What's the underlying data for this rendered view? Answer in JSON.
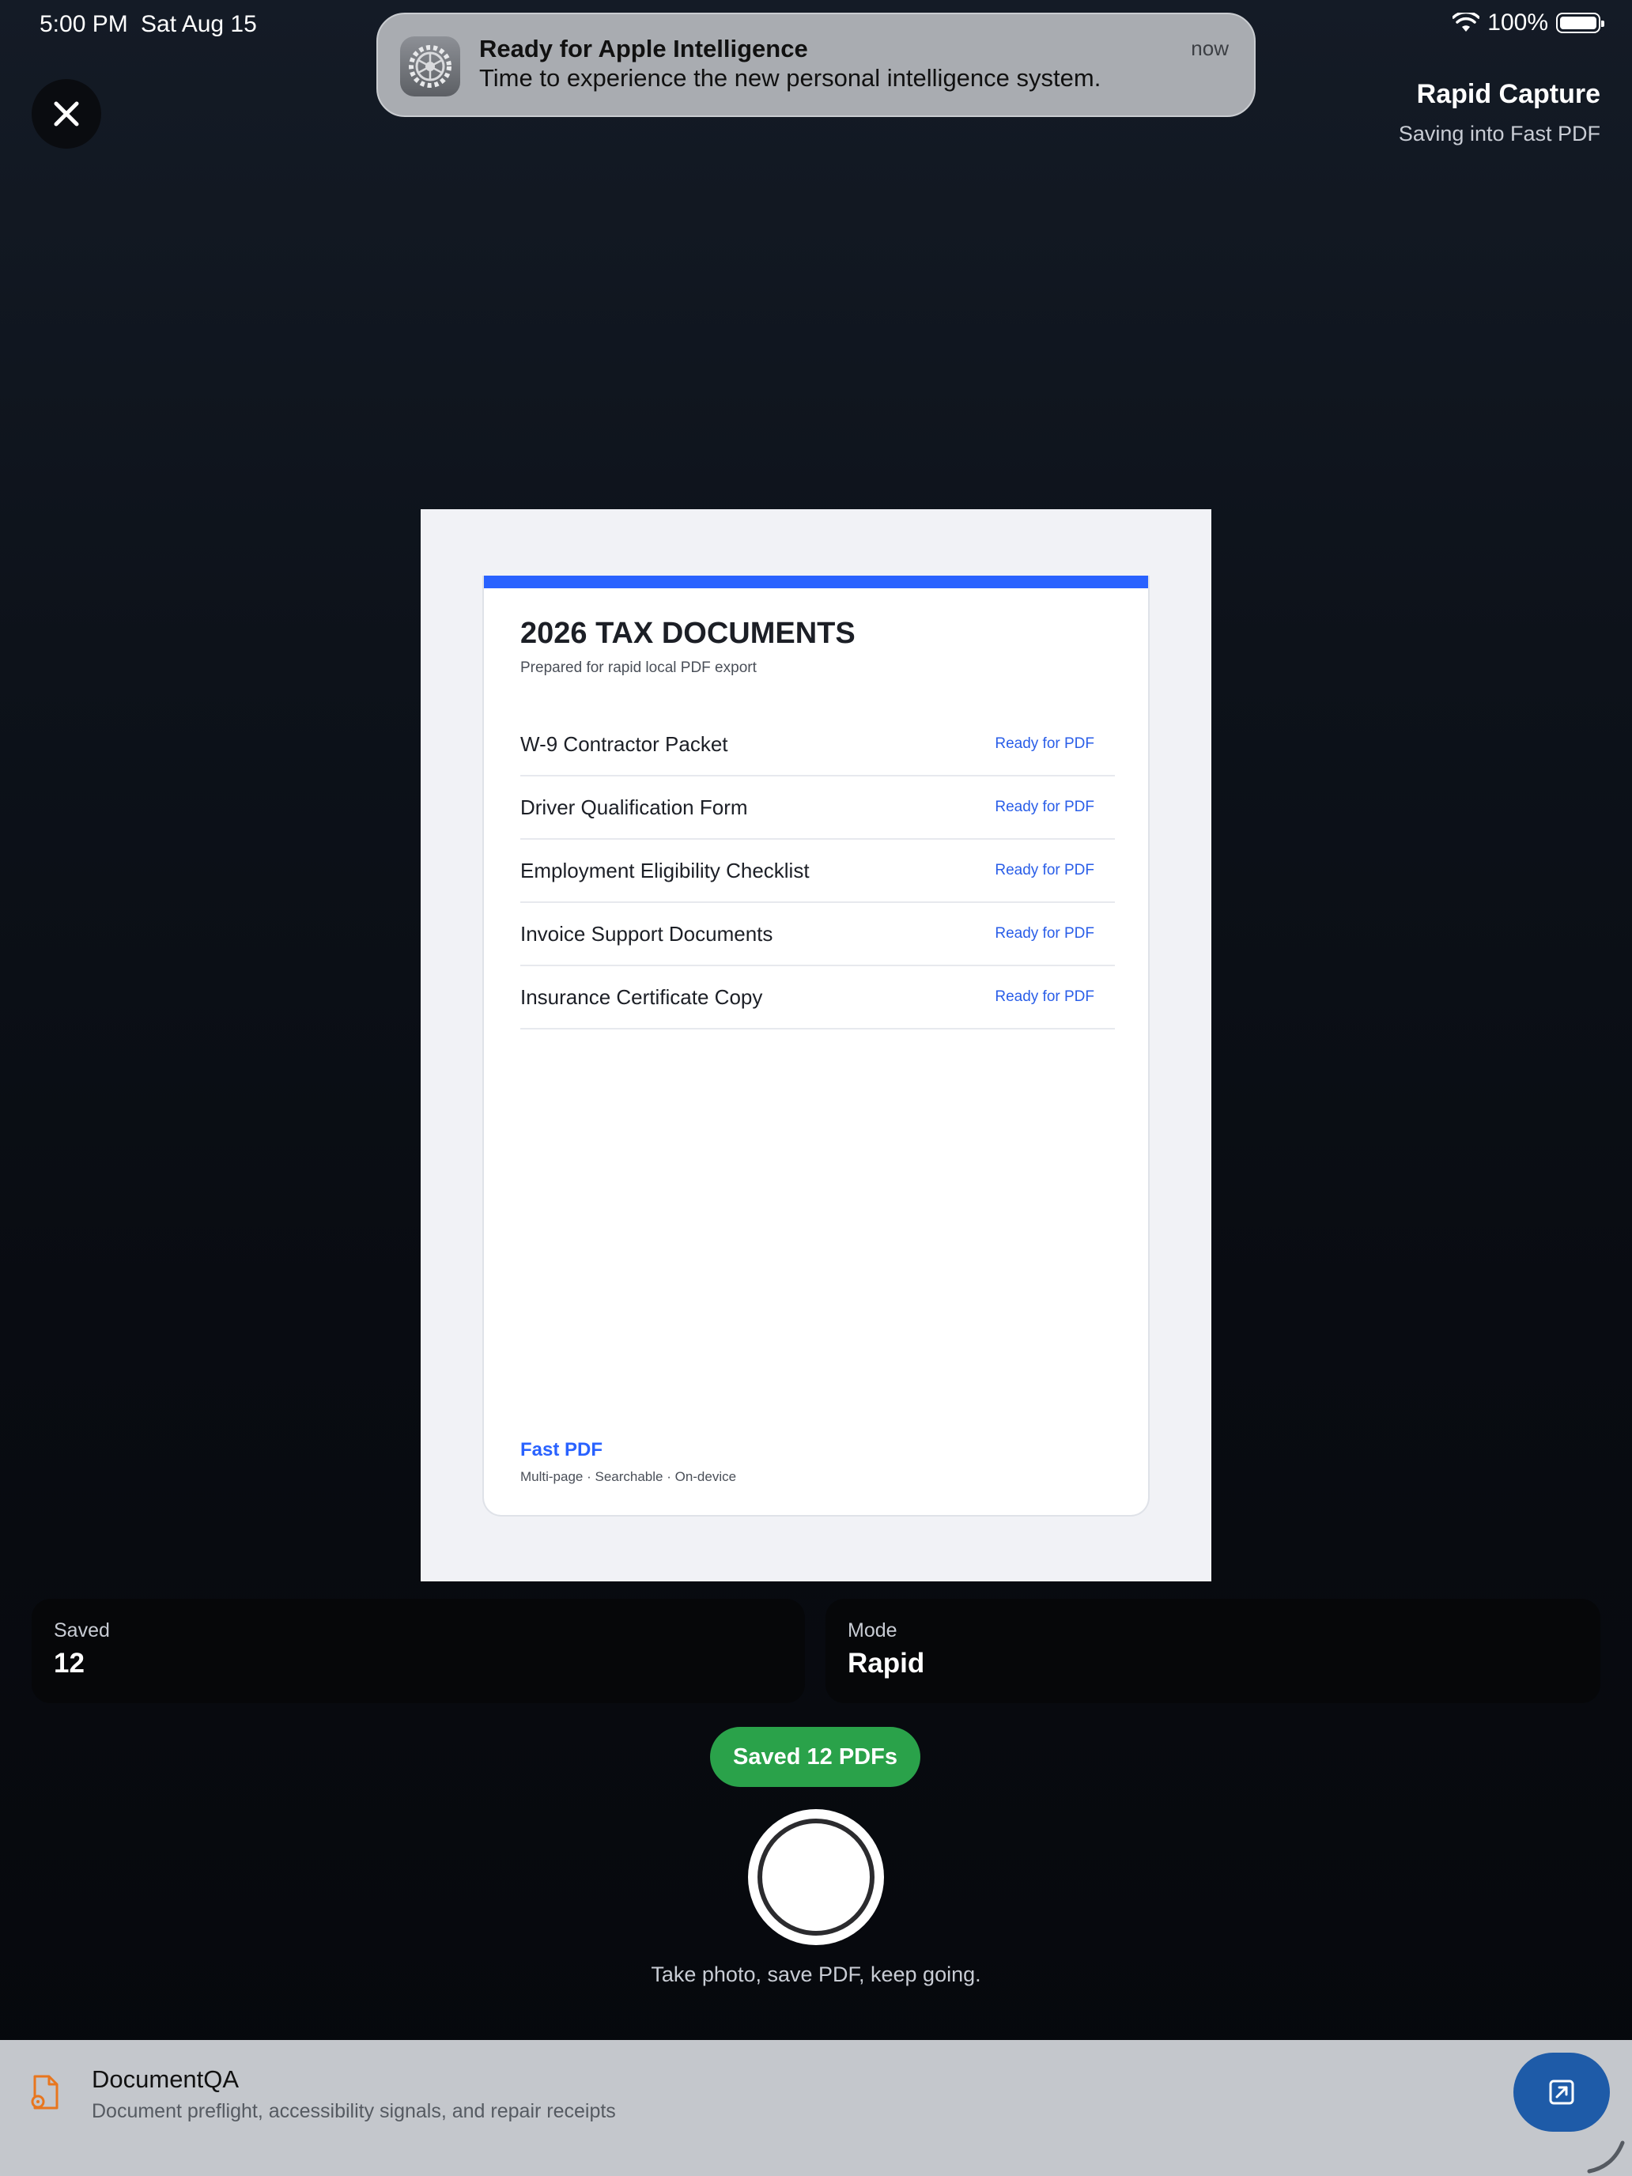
{
  "status_bar": {
    "time": "5:00 PM",
    "date": "Sat Aug 15",
    "battery": "100%"
  },
  "notification": {
    "title": "Ready for Apple Intelligence",
    "body": "Time to experience the new personal intelligence system.",
    "time": "now",
    "icon": "settings-gear-icon"
  },
  "header": {
    "title": "Rapid Capture",
    "subtitle": "Saving into Fast PDF"
  },
  "document": {
    "title": "2026 TAX DOCUMENTS",
    "subtitle": "Prepared for rapid local PDF export",
    "rows": [
      {
        "label": "W-9 Contractor Packet",
        "status": "Ready for PDF"
      },
      {
        "label": "Driver Qualification Form",
        "status": "Ready for PDF"
      },
      {
        "label": "Employment Eligibility Checklist",
        "status": "Ready for PDF"
      },
      {
        "label": "Invoice Support Documents",
        "status": "Ready for PDF"
      },
      {
        "label": "Insurance Certificate Copy",
        "status": "Ready for PDF"
      }
    ],
    "footer_brand": "Fast PDF",
    "footer_sub": "Multi-page · Searchable · On-device"
  },
  "stats": {
    "saved": {
      "label": "Saved",
      "value": "12"
    },
    "mode": {
      "label": "Mode",
      "value": "Rapid"
    }
  },
  "saved_pill": "Saved 12 PDFs",
  "shutter_caption": "Take photo, save PDF, keep going.",
  "banner": {
    "title": "DocumentQA",
    "subtitle": "Document preflight, accessibility signals, and repair receipts",
    "icon": "document-gear-icon",
    "action_icon": "open-external-icon"
  },
  "colors": {
    "accent": "#2962ff",
    "success": "#2aa24a",
    "banner_button": "#1e5ba8",
    "icon_orange": "#e8761e"
  }
}
